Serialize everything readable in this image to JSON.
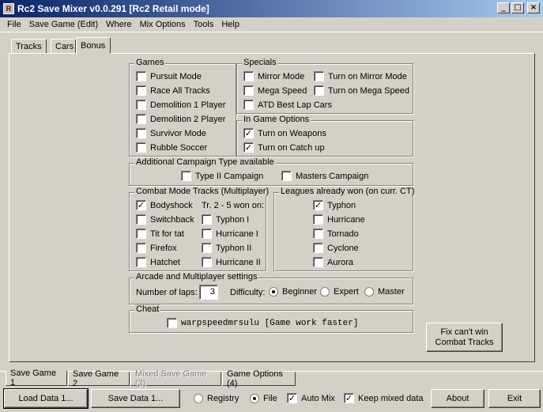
{
  "window": {
    "title": "Rc2 Save Mixer v0.0.291 [Rc2 Retail mode]"
  },
  "menu": [
    "File",
    "Save Game (Edit)",
    "Where",
    "Mix Options",
    "Tools",
    "Help"
  ],
  "tabs": [
    "Tracks",
    "Cars",
    "Bonus"
  ],
  "games": {
    "title": "Games",
    "items": [
      {
        "label": "Pursuit Mode",
        "checked": false
      },
      {
        "label": "Race All Tracks",
        "checked": false
      },
      {
        "label": "Demolition 1 Player",
        "checked": false
      },
      {
        "label": "Demolition 2 Player",
        "checked": false
      },
      {
        "label": "Survivor Mode",
        "checked": false
      },
      {
        "label": "Rubble Soccer",
        "checked": false
      }
    ]
  },
  "specials": {
    "title": "Specials",
    "items": [
      {
        "label": "Mirror Mode",
        "checked": false
      },
      {
        "label": "Turn on Mirror Mode",
        "checked": false
      },
      {
        "label": "Mega Speed",
        "checked": false
      },
      {
        "label": "Turn on Mega Speed",
        "checked": false
      },
      {
        "label": "ATD Best Lap Cars",
        "checked": false
      }
    ]
  },
  "in_game": {
    "title": "In Game Options",
    "items": [
      {
        "label": "Turn on Weapons",
        "checked": true
      },
      {
        "label": "Turn on Catch up",
        "checked": true
      }
    ]
  },
  "campaign": {
    "title": "Additional Campaign Type available",
    "items": [
      {
        "label": "Type II Campaign",
        "checked": false
      },
      {
        "label": "Masters Campaign",
        "checked": false
      }
    ]
  },
  "combat": {
    "title": "Combat Mode Tracks (Multiplayer)",
    "won_label": "Tr. 2 - 5 won on:",
    "tracks": [
      {
        "label": "Bodyshock",
        "checked": true
      },
      {
        "label": "Switchback",
        "checked": false
      },
      {
        "label": "Tit for tat",
        "checked": false
      },
      {
        "label": "Firefox",
        "checked": false
      },
      {
        "label": "Hatchet",
        "checked": false
      }
    ],
    "won_on": [
      {
        "label": "Typhon I",
        "checked": false
      },
      {
        "label": "Hurricane I",
        "checked": false
      },
      {
        "label": "Typhon II",
        "checked": false
      },
      {
        "label": "Hurricane II",
        "checked": false
      }
    ]
  },
  "leagues": {
    "title": "Leagues already won (on curr. CT)",
    "items": [
      {
        "label": "Typhon",
        "checked": true
      },
      {
        "label": "Hurricane",
        "checked": false
      },
      {
        "label": "Tornado",
        "checked": false
      },
      {
        "label": "Cyclone",
        "checked": false
      },
      {
        "label": "Aurora",
        "checked": false
      }
    ]
  },
  "arcade": {
    "title": "Arcade and Multiplayer settings",
    "laps_label": "Number of laps:",
    "laps_value": "3",
    "difficulty_label": "Difficulty:",
    "difficulty": [
      {
        "label": "Beginner",
        "selected": true
      },
      {
        "label": "Expert",
        "selected": false
      },
      {
        "label": "Master",
        "selected": false
      }
    ]
  },
  "cheat": {
    "title": "Cheat",
    "item": {
      "label": "warpspeedmrsulu [Game work faster]",
      "checked": false
    }
  },
  "fix_button": {
    "line1": "Fix can't win",
    "line2": "Combat Tracks"
  },
  "bottom_tabs": [
    "Save Game 1",
    "Save Game 2",
    "Mixed Save Game (3)",
    "Game Options (4)"
  ],
  "footer": {
    "load": "Load Data 1...",
    "save": "Save Data 1...",
    "registry": "Registry",
    "file": "File",
    "auto_mix": "Auto Mix",
    "keep_mixed": "Keep mixed data",
    "about": "About",
    "exit": "Exit"
  },
  "check_glyph": "✓"
}
